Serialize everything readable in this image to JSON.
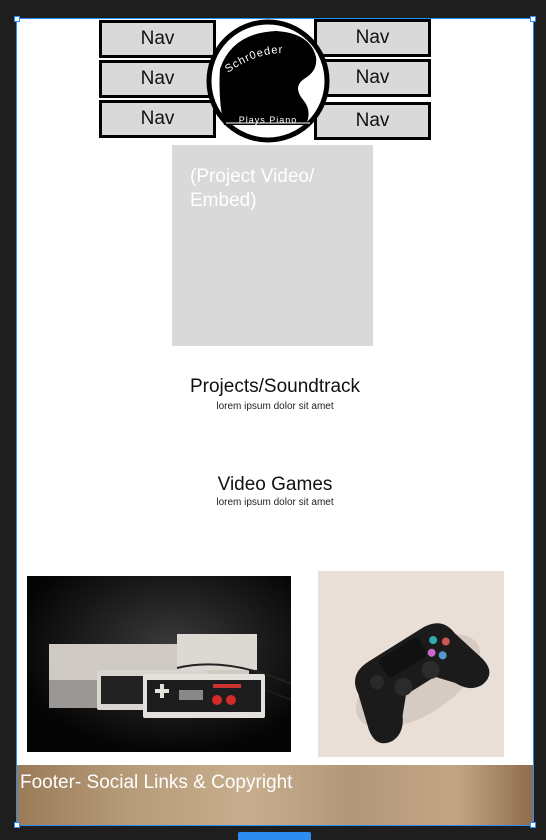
{
  "nav": {
    "left": [
      "Nav",
      "Nav",
      "Nav"
    ],
    "right": [
      "Nav",
      "Nav",
      "Nav"
    ]
  },
  "logo": {
    "top_text": "Schr0eder",
    "bottom_text": "Plays Piano",
    "icon": "grand-piano-silhouette"
  },
  "video": {
    "placeholder": "(Project Video/ Embed)"
  },
  "sections": [
    {
      "title": "Projects/Soundtrack",
      "subtitle": "lorem ipsum dolor sit amet"
    },
    {
      "title": "Video Games",
      "subtitle": "lorem ipsum dolor sit amet"
    }
  ],
  "images": {
    "left": "retro-console-controllers-photo",
    "right": "gamepad-controller-photo"
  },
  "footer": {
    "text": "Footer- Social Links & Copyright"
  },
  "colors": {
    "canvas": "#1e1e1e",
    "selection": "#2d8cf0",
    "nav_fill": "#d9d9d9",
    "footer_brown": "#b79c7a"
  }
}
